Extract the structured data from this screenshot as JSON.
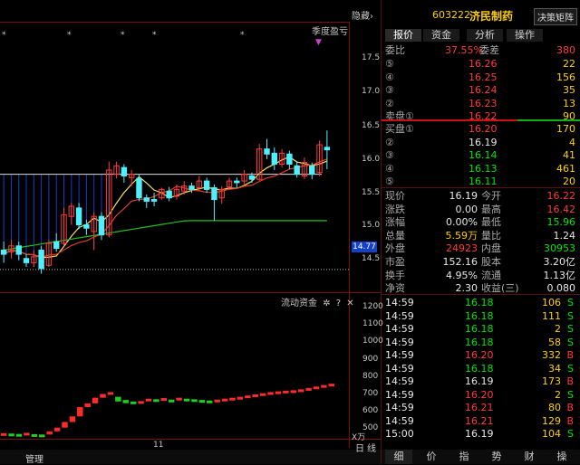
{
  "header": {
    "hide_label": "隐藏",
    "stock_code": "603222",
    "stock_name": "济民制药",
    "decision_button": "决策矩阵"
  },
  "tabs": [
    "报价",
    "资金",
    "分析",
    "操作"
  ],
  "order_book": {
    "ratio_label": "委比",
    "ratio_value": "37.55%",
    "diff_label": "委差",
    "diff_value": "380",
    "asks": [
      {
        "level": "⑤",
        "price": "16.26",
        "vol": "22"
      },
      {
        "level": "④",
        "price": "16.25",
        "vol": "156"
      },
      {
        "level": "③",
        "price": "16.24",
        "vol": "35"
      },
      {
        "level": "②",
        "price": "16.23",
        "vol": "13"
      },
      {
        "level": "卖盘①",
        "price": "16.22",
        "vol": "90"
      }
    ],
    "bids": [
      {
        "level": "买盘①",
        "price": "16.20",
        "vol": "170"
      },
      {
        "level": "②",
        "price": "16.19",
        "vol": "4"
      },
      {
        "level": "③",
        "price": "16.14",
        "vol": "41"
      },
      {
        "level": "④",
        "price": "16.13",
        "vol": "461"
      },
      {
        "level": "⑤",
        "price": "16.11",
        "vol": "20"
      }
    ]
  },
  "quote_stats": [
    {
      "l1": "现价",
      "v1": "16.19",
      "l2": "今开",
      "v2": "16.22"
    },
    {
      "l1": "涨跌",
      "v1": "0.00",
      "l2": "最高",
      "v2": "16.42"
    },
    {
      "l1": "涨幅",
      "v1": "0.00%",
      "l2": "最低",
      "v2": "15.96"
    },
    {
      "l1": "总量",
      "v1": "5.59万",
      "l2": "量比",
      "v2": "1.24"
    },
    {
      "l1": "外盘",
      "v1": "24923",
      "l2": "内盘",
      "v2": "30953"
    },
    {
      "l1": "市盈",
      "v1": "152.16",
      "l2": "股本",
      "v2": "3.20亿"
    },
    {
      "l1": "换手",
      "v1": "4.95%",
      "l2": "流通",
      "v2": "1.13亿"
    },
    {
      "l1": "净资",
      "v1": "2.30",
      "l2": "收益(三)",
      "v2": "0.080"
    }
  ],
  "ticks": [
    {
      "time": "14:59",
      "price": "16.18",
      "vol": "106",
      "bs": "S"
    },
    {
      "time": "14:59",
      "price": "16.18",
      "vol": "111",
      "bs": "S"
    },
    {
      "time": "14:59",
      "price": "16.18",
      "vol": "2",
      "bs": "S"
    },
    {
      "time": "14:59",
      "price": "16.18",
      "vol": "58",
      "bs": "S"
    },
    {
      "time": "14:59",
      "price": "16.20",
      "vol": "332",
      "bs": "B"
    },
    {
      "time": "14:59",
      "price": "16.18",
      "vol": "34",
      "bs": "S"
    },
    {
      "time": "14:59",
      "price": "16.19",
      "vol": "173",
      "bs": "B"
    },
    {
      "time": "14:59",
      "price": "16.20",
      "vol": "2",
      "bs": "S"
    },
    {
      "time": "14:59",
      "price": "16.21",
      "vol": "80",
      "bs": "B"
    },
    {
      "time": "14:59",
      "price": "16.21",
      "vol": "129",
      "bs": "B"
    },
    {
      "time": "15:00",
      "price": "16.19",
      "vol": "104",
      "bs": "S"
    }
  ],
  "bottom_tabs": [
    "细",
    "价",
    "指",
    "势",
    "财",
    "操"
  ],
  "main_chart": {
    "y_labels": [
      "17.5",
      "17.0",
      "16.5",
      "16.0",
      "15.5",
      "15.0",
      "14.5"
    ],
    "current_price_tag": "14.77",
    "quarter_label": "季度盈亏",
    "subchart_title": "流动资金",
    "sub_y_labels": [
      "1200",
      "1100",
      "1000",
      "900",
      "800",
      "700",
      "600",
      "500"
    ],
    "sub_unit": "X万",
    "x_label": "11",
    "period_buttons": [
      "日",
      "线"
    ],
    "manage_button": "管理"
  },
  "chart_data": {
    "type": "candlestick",
    "ylim": [
      14.5,
      17.7
    ],
    "candles": [
      {
        "o": 15.0,
        "c": 14.95,
        "h": 15.1,
        "l": 14.85
      },
      {
        "o": 14.98,
        "c": 15.05,
        "h": 15.12,
        "l": 14.9
      },
      {
        "o": 15.05,
        "c": 14.95,
        "h": 15.1,
        "l": 14.88
      },
      {
        "o": 14.9,
        "c": 14.85,
        "h": 14.95,
        "l": 14.8
      },
      {
        "o": 14.85,
        "c": 14.92,
        "h": 15.0,
        "l": 14.8
      },
      {
        "o": 15.0,
        "c": 14.78,
        "h": 15.05,
        "l": 14.72
      },
      {
        "o": 14.82,
        "c": 15.08,
        "h": 15.12,
        "l": 14.8
      },
      {
        "o": 15.1,
        "c": 15.02,
        "h": 15.2,
        "l": 14.98
      },
      {
        "o": 15.08,
        "c": 15.42,
        "h": 15.5,
        "l": 15.05
      },
      {
        "o": 15.4,
        "c": 15.52,
        "h": 15.56,
        "l": 15.3
      },
      {
        "o": 15.5,
        "c": 15.3,
        "h": 15.56,
        "l": 15.25
      },
      {
        "o": 15.3,
        "c": 15.26,
        "h": 15.36,
        "l": 15.18
      },
      {
        "o": 15.22,
        "c": 15.4,
        "h": 15.45,
        "l": 15.0
      },
      {
        "o": 15.4,
        "c": 15.18,
        "h": 15.45,
        "l": 15.12
      },
      {
        "o": 15.18,
        "c": 15.95,
        "h": 16.05,
        "l": 15.15
      },
      {
        "o": 15.9,
        "c": 16.0,
        "h": 16.05,
        "l": 15.85
      },
      {
        "o": 15.98,
        "c": 15.88,
        "h": 16.02,
        "l": 15.8
      },
      {
        "o": 15.86,
        "c": 15.9,
        "h": 15.95,
        "l": 15.76
      },
      {
        "o": 15.85,
        "c": 15.62,
        "h": 15.9,
        "l": 15.58
      },
      {
        "o": 15.62,
        "c": 15.58,
        "h": 15.66,
        "l": 15.5
      },
      {
        "o": 15.6,
        "c": 15.58,
        "h": 15.68,
        "l": 15.52
      },
      {
        "o": 15.62,
        "c": 15.72,
        "h": 15.74,
        "l": 15.6
      },
      {
        "o": 15.7,
        "c": 15.62,
        "h": 15.75,
        "l": 15.58
      },
      {
        "o": 15.64,
        "c": 15.72,
        "h": 15.78,
        "l": 15.6
      },
      {
        "o": 15.7,
        "c": 15.76,
        "h": 15.82,
        "l": 15.66
      },
      {
        "o": 15.76,
        "c": 15.72,
        "h": 15.8,
        "l": 15.68
      },
      {
        "o": 15.74,
        "c": 15.82,
        "h": 15.88,
        "l": 15.7
      },
      {
        "o": 15.82,
        "c": 15.72,
        "h": 15.86,
        "l": 15.68
      },
      {
        "o": 15.74,
        "c": 15.6,
        "h": 15.78,
        "l": 15.35
      },
      {
        "o": 15.62,
        "c": 15.72,
        "h": 15.76,
        "l": 15.55
      },
      {
        "o": 15.75,
        "c": 15.82,
        "h": 15.86,
        "l": 15.72
      },
      {
        "o": 15.82,
        "c": 15.8,
        "h": 15.86,
        "l": 15.74
      },
      {
        "o": 15.82,
        "c": 15.9,
        "h": 15.95,
        "l": 15.78
      },
      {
        "o": 15.88,
        "c": 15.84,
        "h": 15.92,
        "l": 15.8
      },
      {
        "o": 15.84,
        "c": 16.2,
        "h": 16.26,
        "l": 15.82
      },
      {
        "o": 16.2,
        "c": 16.14,
        "h": 16.32,
        "l": 16.08
      },
      {
        "o": 16.15,
        "c": 16.02,
        "h": 16.22,
        "l": 15.95
      },
      {
        "o": 16.02,
        "c": 16.15,
        "h": 16.2,
        "l": 15.98
      },
      {
        "o": 16.14,
        "c": 16.02,
        "h": 16.18,
        "l": 15.96
      },
      {
        "o": 16.0,
        "c": 15.9,
        "h": 16.05,
        "l": 15.86
      },
      {
        "o": 15.88,
        "c": 16.04,
        "h": 16.1,
        "l": 15.84
      },
      {
        "o": 16.0,
        "c": 15.9,
        "h": 16.04,
        "l": 15.84
      },
      {
        "o": 15.92,
        "c": 16.25,
        "h": 16.3,
        "l": 15.88
      },
      {
        "o": 16.22,
        "c": 16.19,
        "h": 16.42,
        "l": 15.96
      }
    ],
    "volume": [
      470,
      468,
      466,
      472,
      465,
      463,
      480,
      500,
      530,
      560,
      610,
      630,
      660,
      680,
      690,
      665,
      648,
      640,
      642,
      655,
      652,
      658,
      650,
      660,
      655,
      652,
      648,
      645,
      650,
      655,
      660,
      665,
      672,
      678,
      684,
      690,
      694,
      698,
      700,
      705,
      712,
      720,
      728,
      735
    ]
  }
}
